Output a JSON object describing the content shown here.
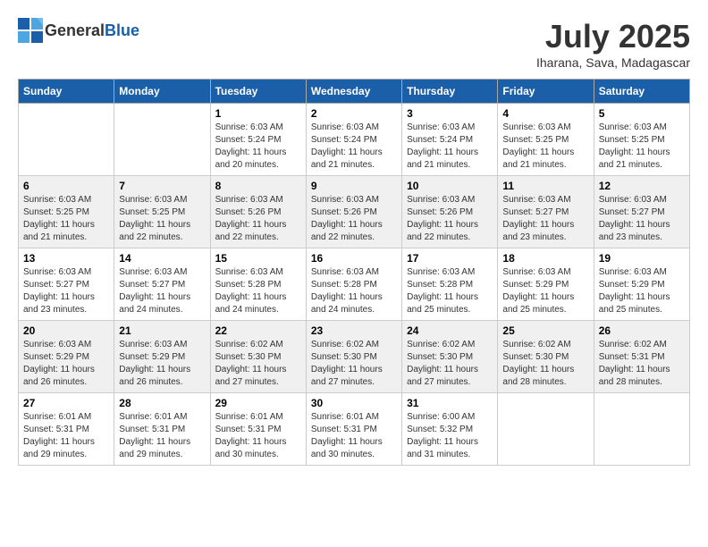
{
  "header": {
    "logo_general": "General",
    "logo_blue": "Blue",
    "month": "July 2025",
    "location": "Iharana, Sava, Madagascar"
  },
  "days_of_week": [
    "Sunday",
    "Monday",
    "Tuesday",
    "Wednesday",
    "Thursday",
    "Friday",
    "Saturday"
  ],
  "weeks": [
    [
      {
        "day": "",
        "info": ""
      },
      {
        "day": "",
        "info": ""
      },
      {
        "day": "1",
        "sunrise": "6:03 AM",
        "sunset": "5:24 PM",
        "daylight": "11 hours and 20 minutes."
      },
      {
        "day": "2",
        "sunrise": "6:03 AM",
        "sunset": "5:24 PM",
        "daylight": "11 hours and 21 minutes."
      },
      {
        "day": "3",
        "sunrise": "6:03 AM",
        "sunset": "5:24 PM",
        "daylight": "11 hours and 21 minutes."
      },
      {
        "day": "4",
        "sunrise": "6:03 AM",
        "sunset": "5:25 PM",
        "daylight": "11 hours and 21 minutes."
      },
      {
        "day": "5",
        "sunrise": "6:03 AM",
        "sunset": "5:25 PM",
        "daylight": "11 hours and 21 minutes."
      }
    ],
    [
      {
        "day": "6",
        "sunrise": "6:03 AM",
        "sunset": "5:25 PM",
        "daylight": "11 hours and 21 minutes."
      },
      {
        "day": "7",
        "sunrise": "6:03 AM",
        "sunset": "5:25 PM",
        "daylight": "11 hours and 22 minutes."
      },
      {
        "day": "8",
        "sunrise": "6:03 AM",
        "sunset": "5:26 PM",
        "daylight": "11 hours and 22 minutes."
      },
      {
        "day": "9",
        "sunrise": "6:03 AM",
        "sunset": "5:26 PM",
        "daylight": "11 hours and 22 minutes."
      },
      {
        "day": "10",
        "sunrise": "6:03 AM",
        "sunset": "5:26 PM",
        "daylight": "11 hours and 22 minutes."
      },
      {
        "day": "11",
        "sunrise": "6:03 AM",
        "sunset": "5:27 PM",
        "daylight": "11 hours and 23 minutes."
      },
      {
        "day": "12",
        "sunrise": "6:03 AM",
        "sunset": "5:27 PM",
        "daylight": "11 hours and 23 minutes."
      }
    ],
    [
      {
        "day": "13",
        "sunrise": "6:03 AM",
        "sunset": "5:27 PM",
        "daylight": "11 hours and 23 minutes."
      },
      {
        "day": "14",
        "sunrise": "6:03 AM",
        "sunset": "5:27 PM",
        "daylight": "11 hours and 24 minutes."
      },
      {
        "day": "15",
        "sunrise": "6:03 AM",
        "sunset": "5:28 PM",
        "daylight": "11 hours and 24 minutes."
      },
      {
        "day": "16",
        "sunrise": "6:03 AM",
        "sunset": "5:28 PM",
        "daylight": "11 hours and 24 minutes."
      },
      {
        "day": "17",
        "sunrise": "6:03 AM",
        "sunset": "5:28 PM",
        "daylight": "11 hours and 25 minutes."
      },
      {
        "day": "18",
        "sunrise": "6:03 AM",
        "sunset": "5:29 PM",
        "daylight": "11 hours and 25 minutes."
      },
      {
        "day": "19",
        "sunrise": "6:03 AM",
        "sunset": "5:29 PM",
        "daylight": "11 hours and 25 minutes."
      }
    ],
    [
      {
        "day": "20",
        "sunrise": "6:03 AM",
        "sunset": "5:29 PM",
        "daylight": "11 hours and 26 minutes."
      },
      {
        "day": "21",
        "sunrise": "6:03 AM",
        "sunset": "5:29 PM",
        "daylight": "11 hours and 26 minutes."
      },
      {
        "day": "22",
        "sunrise": "6:02 AM",
        "sunset": "5:30 PM",
        "daylight": "11 hours and 27 minutes."
      },
      {
        "day": "23",
        "sunrise": "6:02 AM",
        "sunset": "5:30 PM",
        "daylight": "11 hours and 27 minutes."
      },
      {
        "day": "24",
        "sunrise": "6:02 AM",
        "sunset": "5:30 PM",
        "daylight": "11 hours and 27 minutes."
      },
      {
        "day": "25",
        "sunrise": "6:02 AM",
        "sunset": "5:30 PM",
        "daylight": "11 hours and 28 minutes."
      },
      {
        "day": "26",
        "sunrise": "6:02 AM",
        "sunset": "5:31 PM",
        "daylight": "11 hours and 28 minutes."
      }
    ],
    [
      {
        "day": "27",
        "sunrise": "6:01 AM",
        "sunset": "5:31 PM",
        "daylight": "11 hours and 29 minutes."
      },
      {
        "day": "28",
        "sunrise": "6:01 AM",
        "sunset": "5:31 PM",
        "daylight": "11 hours and 29 minutes."
      },
      {
        "day": "29",
        "sunrise": "6:01 AM",
        "sunset": "5:31 PM",
        "daylight": "11 hours and 30 minutes."
      },
      {
        "day": "30",
        "sunrise": "6:01 AM",
        "sunset": "5:31 PM",
        "daylight": "11 hours and 30 minutes."
      },
      {
        "day": "31",
        "sunrise": "6:00 AM",
        "sunset": "5:32 PM",
        "daylight": "11 hours and 31 minutes."
      },
      {
        "day": "",
        "info": ""
      },
      {
        "day": "",
        "info": ""
      }
    ]
  ],
  "labels": {
    "sunrise_prefix": "Sunrise: ",
    "sunset_prefix": "Sunset: ",
    "daylight_prefix": "Daylight: "
  }
}
